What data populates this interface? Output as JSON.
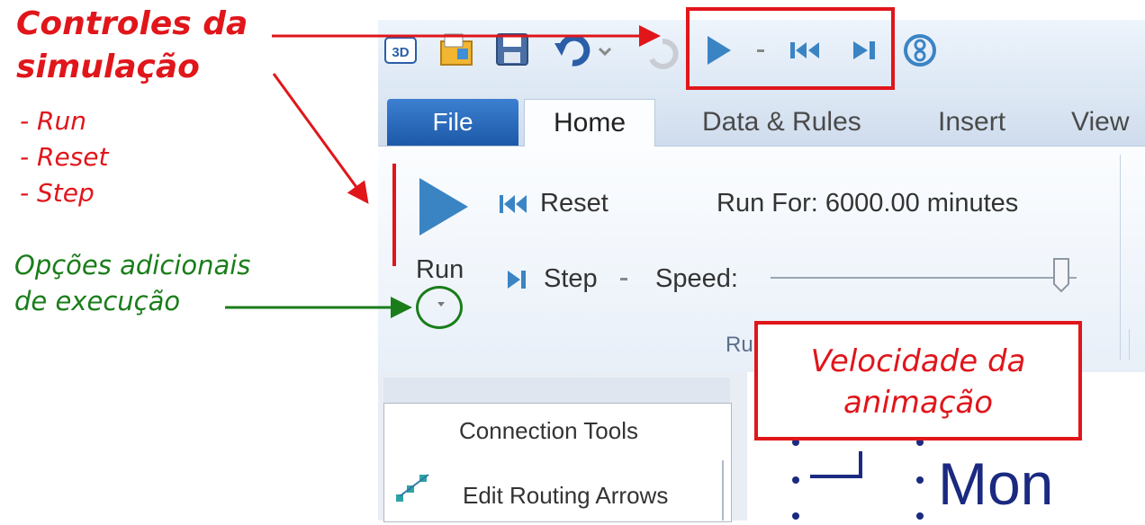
{
  "toolbar": {
    "tabs": [
      "File",
      "Home",
      "Data & Rules",
      "Insert",
      "View"
    ]
  },
  "run_group": {
    "run_label": "Run",
    "reset_label": "Reset",
    "step_label": "Step",
    "run_for": "Run For: 6000.00 minutes",
    "speed_label": "Speed:",
    "speed_level": 0.95,
    "group_label": "Ru"
  },
  "connection_panel": {
    "title": "Connection Tools",
    "item": "Edit Routing Arrows"
  },
  "canvas": {
    "text": "Mon"
  },
  "annotations": {
    "controls_line1": "Controles da",
    "controls_line2": "simulação",
    "bullets": [
      "- Run",
      "- Reset",
      "- Step"
    ],
    "options_line1": "Opções adicionais",
    "options_line2": "de execução",
    "speed_line1": "Velocidade da",
    "speed_line2": "animação"
  },
  "colors": {
    "annotation_red": "#e0161b",
    "annotation_green": "#1a7d1a",
    "play_blue": "#3b84c4",
    "file_tab": "#2a6ab8"
  }
}
